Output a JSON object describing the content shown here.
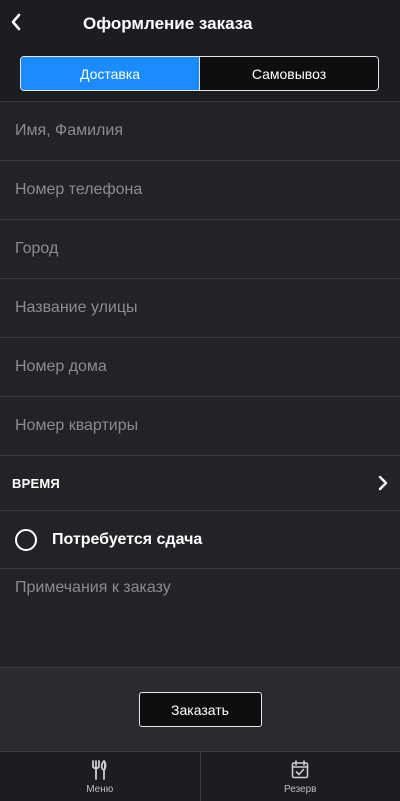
{
  "header": {
    "title": "Оформление заказа",
    "back_icon": "chevron-left-icon"
  },
  "delivery_toggle": {
    "options": [
      "Доставка",
      "Самовывоз"
    ],
    "selected": "Доставка",
    "active_color": "#1a8cff"
  },
  "form": {
    "name_placeholder": "Имя, Фамилия",
    "phone_placeholder": "Номер телефона",
    "city_placeholder": "Город",
    "street_placeholder": "Название улицы",
    "house_placeholder": "Номер дома",
    "apartment_placeholder": "Номер квартиры",
    "time_label": "ВРЕМЯ",
    "time_icon": "chevron-right-icon",
    "change_label": "Потребуется сдача",
    "change_checked": false,
    "notes_placeholder": "Примечания к заказу"
  },
  "order_button": {
    "label": "Заказать"
  },
  "tabbar": {
    "tabs": [
      {
        "label": "Меню",
        "icon": "fork-knife-icon"
      },
      {
        "label": "Резерв",
        "icon": "calendar-check-icon"
      }
    ]
  }
}
